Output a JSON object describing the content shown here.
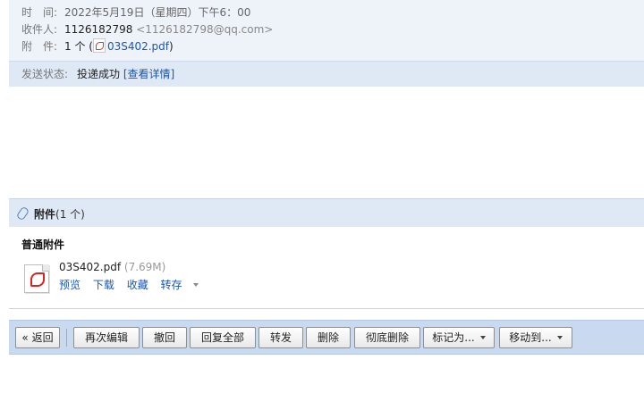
{
  "header": {
    "time_label": "时　间:",
    "time_value": "2022年5月19日（星期四）下午6：00",
    "recipient_label": "收件人:",
    "recipient_name": "1126182798",
    "recipient_email": "<1126182798@qq.com>",
    "attachment_label": "附　件:",
    "attachment_count": "1 个 (",
    "attachment_file": "03S402.pdf",
    "attachment_close": ")"
  },
  "status": {
    "label": "发送状态:",
    "value": "投递成功",
    "details_link": "[查看详情]"
  },
  "attachments": {
    "title": "附件",
    "count": "(1 个)",
    "section_title": "普通附件",
    "file": {
      "name": "03S402.pdf",
      "size": "(7.69M)",
      "actions": {
        "preview": "预览",
        "download": "下载",
        "favorite": "收藏",
        "save_to": "转存"
      }
    }
  },
  "toolbar": {
    "back": "« 返回",
    "edit_again": "再次编辑",
    "recall": "撤回",
    "reply_all": "回复全部",
    "forward": "转发",
    "delete": "删除",
    "delete_permanently": "彻底删除",
    "mark_as": "标记为...",
    "move_to": "移动到..."
  },
  "colors": {
    "header_bg": "#eef3fa",
    "panel_bg": "#dfe8f5",
    "toolbar_bg": "#c9daf0",
    "link": "#1a56b0"
  }
}
